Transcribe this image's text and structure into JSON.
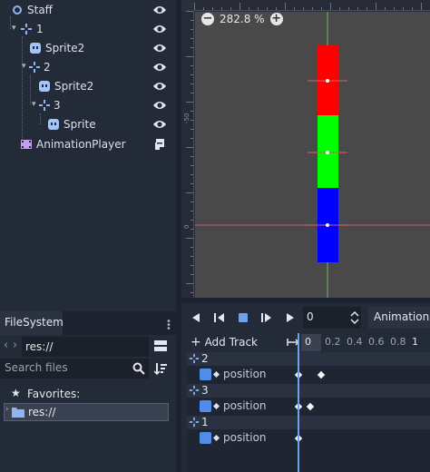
{
  "scene_tree": {
    "nodes": [
      {
        "name": "Staff"
      },
      {
        "name": "1"
      },
      {
        "name": "Sprite2"
      },
      {
        "name": "2"
      },
      {
        "name": "Sprite2"
      },
      {
        "name": "3"
      },
      {
        "name": "Sprite"
      },
      {
        "name": "AnimationPlayer"
      }
    ]
  },
  "viewport": {
    "zoom": "282.8 %",
    "ruler_left_labels": [
      "-50",
      "0"
    ],
    "colors": {
      "red": "#ff0000",
      "green": "#00ff00",
      "blue": "#0000ff",
      "background": "#494949"
    }
  },
  "filesystem": {
    "tab_label": "FileSystem",
    "path_value": "res://",
    "search_placeholder": "Search files",
    "favorites_label": "Favorites:",
    "res_label": "res://"
  },
  "animation": {
    "time_value": "0",
    "animation_label": "Animation",
    "add_track_label": "Add Track",
    "timeline_labels": [
      "0",
      "0.2",
      "0.4",
      "0.6",
      "0.8",
      "1"
    ],
    "groups": [
      {
        "name": "2",
        "property": "position"
      },
      {
        "name": "3",
        "property": "position"
      },
      {
        "name": "1",
        "property": "position"
      }
    ]
  }
}
